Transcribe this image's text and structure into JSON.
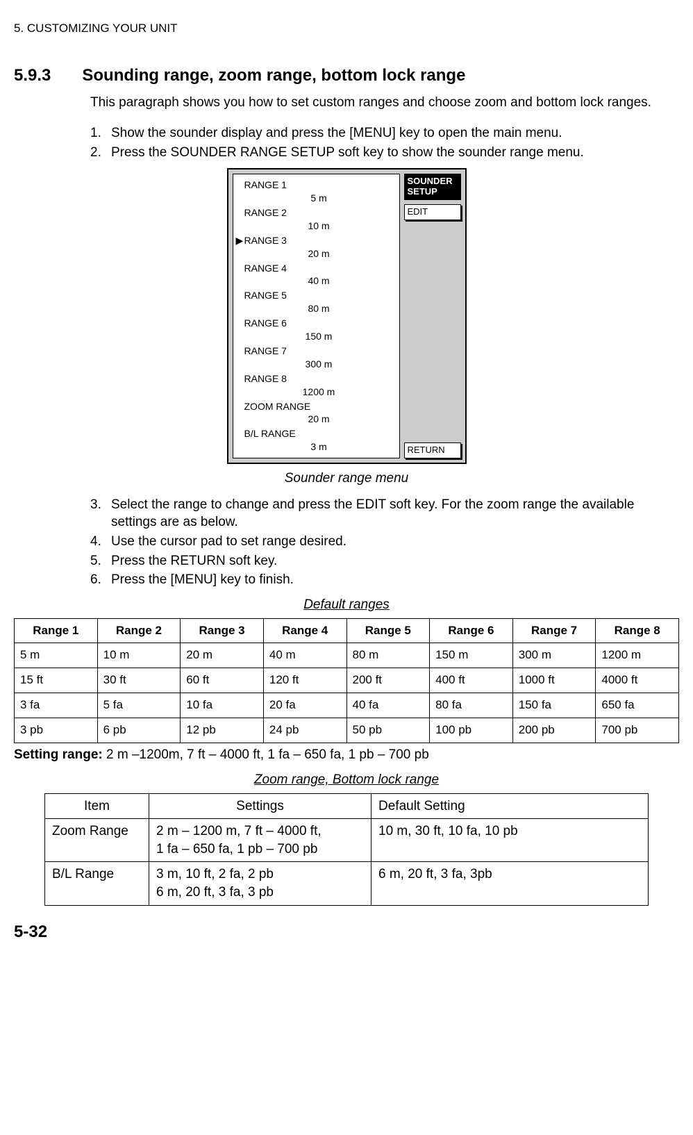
{
  "running_header": "5. CUSTOMIZING YOUR UNIT",
  "section": {
    "number": "5.9.3",
    "title": "Sounding range, zoom range, bottom lock range"
  },
  "intro": "This paragraph shows you how to set custom ranges and choose zoom and bottom lock ranges.",
  "steps_a": [
    "Show the sounder display and press the [MENU] key to open the main menu.",
    "Press the SOUNDER RANGE SETUP soft key to show the sounder range menu."
  ],
  "menu": {
    "selected": 2,
    "items": [
      {
        "label": "RANGE 1",
        "value": "5 m"
      },
      {
        "label": "RANGE 2",
        "value": "10 m"
      },
      {
        "label": "RANGE 3",
        "value": "20 m"
      },
      {
        "label": "RANGE 4",
        "value": "40 m"
      },
      {
        "label": "RANGE 5",
        "value": "80 m"
      },
      {
        "label": "RANGE 6",
        "value": "150 m"
      },
      {
        "label": "RANGE 7",
        "value": "300 m"
      },
      {
        "label": "RANGE 8",
        "value": "1200 m"
      },
      {
        "label": "ZOOM RANGE",
        "value": "20 m"
      },
      {
        "label": "B/L RANGE",
        "value": "3 m"
      }
    ],
    "soft_keys": {
      "header1": "SOUNDER",
      "header2": "SETUP",
      "edit": "EDIT",
      "return": "RETURN"
    }
  },
  "figure_caption": "Sounder range menu",
  "steps_b": [
    "Select the range to change and press the EDIT soft key. For the zoom range the available settings are as below.",
    "Use the cursor pad to set range desired.",
    "Press the RETURN soft key.",
    "Press the [MENU] key to finish."
  ],
  "default_ranges": {
    "caption": "Default ranges",
    "headers": [
      "Range 1",
      "Range 2",
      "Range 3",
      "Range 4",
      "Range 5",
      "Range 6",
      "Range 7",
      "Range 8"
    ],
    "rows": [
      [
        "5 m",
        "10 m",
        "20 m",
        "40 m",
        "80 m",
        "150 m",
        "300 m",
        "1200 m"
      ],
      [
        "15 ft",
        "30 ft",
        "60 ft",
        "120 ft",
        "200 ft",
        "400 ft",
        "1000 ft",
        "4000 ft"
      ],
      [
        "3 fa",
        "5 fa",
        "10 fa",
        "20 fa",
        "40 fa",
        "80 fa",
        "150 fa",
        "650 fa"
      ],
      [
        "3 pb",
        "6 pb",
        "12 pb",
        "24 pb",
        "50 pb",
        "100 pb",
        "200 pb",
        "700 pb"
      ]
    ]
  },
  "setting_range": {
    "label": "Setting range:",
    "text": " 2 m –1200m, 7 ft – 4000 ft, 1 fa – 650 fa, 1 pb – 700 pb"
  },
  "zoom_table": {
    "caption": "Zoom range, Bottom lock range",
    "headers": [
      "Item",
      "Settings",
      "Default Setting"
    ],
    "rows": [
      {
        "item": "Zoom Range",
        "settings": "2 m – 1200 m, 7 ft – 4000 ft,\n1 fa – 650 fa, 1 pb – 700 pb",
        "default": "10 m, 30 ft, 10 fa, 10 pb"
      },
      {
        "item": "B/L Range",
        "settings": "3 m, 10 ft, 2 fa, 2 pb\n6 m, 20 ft, 3 fa, 3 pb",
        "default": "6 m, 20 ft, 3 fa, 3pb"
      }
    ]
  },
  "page_number": "5-32"
}
